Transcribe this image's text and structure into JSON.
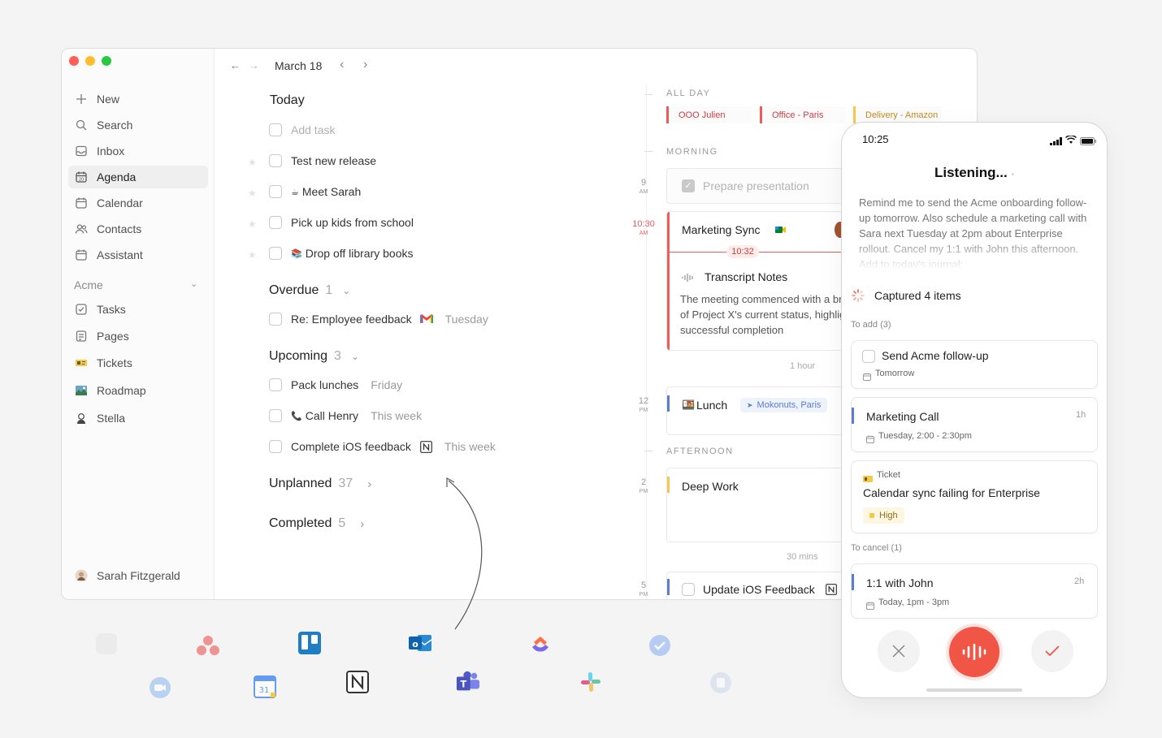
{
  "calendar_header": {
    "back_arrow": "←",
    "forward_arrow": "→",
    "date": "March 18",
    "prev": "‹",
    "next": "›"
  },
  "sidebar": {
    "items": [
      {
        "label": "New",
        "icon": "plus-icon"
      },
      {
        "label": "Search",
        "icon": "search-icon"
      },
      {
        "label": "Inbox",
        "icon": "inbox-icon"
      },
      {
        "label": "Agenda",
        "icon": "agenda-icon"
      },
      {
        "label": "Calendar",
        "icon": "calendar-icon"
      },
      {
        "label": "Contacts",
        "icon": "contacts-icon"
      },
      {
        "label": "Assistant",
        "icon": "assistant-icon"
      }
    ],
    "workspace": "Acme",
    "workspace_items": [
      {
        "label": "Tasks",
        "icon": "tasks-icon"
      },
      {
        "label": "Pages",
        "icon": "pages-icon"
      },
      {
        "label": "Tickets",
        "icon": "tickets-icon"
      },
      {
        "label": "Roadmap",
        "icon": "roadmap-icon"
      },
      {
        "label": "Stella",
        "icon": "stella-avatar"
      }
    ],
    "user": "Sarah Fitzgerald"
  },
  "agenda": {
    "today_title": "Today",
    "add_task_placeholder": "Add task",
    "today_tasks": [
      {
        "label": "Test new release"
      },
      {
        "emoji": "☕",
        "label": "Meet Sarah"
      },
      {
        "label": "Pick up kids from school"
      },
      {
        "emoji": "📚",
        "label": "Drop off library books"
      }
    ],
    "overdue": {
      "title": "Overdue",
      "count": "1",
      "chevron": "⌄"
    },
    "overdue_task": {
      "label": "Re: Employee feedback",
      "due": "Tuesday"
    },
    "upcoming": {
      "title": "Upcoming",
      "count": "3",
      "chevron": "⌄"
    },
    "upcoming_tasks": [
      {
        "label": "Pack lunches",
        "due": "Friday"
      },
      {
        "emoji": "📞",
        "label": "Call Henry",
        "due": "This week"
      },
      {
        "label": "Complete iOS feedback",
        "due": "This week"
      }
    ],
    "unplanned": {
      "title": "Unplanned",
      "count": "37",
      "chevron": "›"
    },
    "completed": {
      "title": "Completed",
      "count": "5",
      "chevron": "›"
    }
  },
  "calendar": {
    "all_day_label": "ALL DAY",
    "all_day_events": [
      "OOO Julien",
      "Office - Paris",
      "Delivery - Amazon"
    ],
    "morning_label": "MORNING",
    "afternoon_label": "AFTERNOON",
    "hours": [
      {
        "h": "9",
        "ap": "AM"
      },
      {
        "h": "10:30",
        "ap": "AM"
      },
      {
        "h": "12",
        "ap": "PM"
      },
      {
        "h": "2",
        "ap": "PM"
      },
      {
        "h": "5",
        "ap": "PM"
      }
    ],
    "prepare": "Prepare presentation",
    "marketing_sync": "Marketing Sync",
    "now_time": "10:32",
    "transcript_title": "Transcript Notes",
    "transcript_text": "The meeting commenced with a brief overview of Project X's current status, highlighted the successful completion",
    "one_hour": "1 hour",
    "lunch": "Lunch",
    "lunch_location": "Mokonuts, Paris",
    "deep_work": "Deep Work",
    "thirty_mins": "30 mins",
    "update_ios": "Update iOS Feedback"
  },
  "phone": {
    "time": "10:25",
    "listening": "Listening...",
    "transcript": "Remind me to send the Acme onboarding follow-up tomorrow. Also schedule a marketing call with Sara next Tuesday at 2pm about Enterprise rollout. Cancel my 1:1 with John this afternoon. Add to today's journal:",
    "captured": "Captured 4 items",
    "to_add": "To add (3)",
    "card1": {
      "title": "Send Acme follow-up",
      "date": "Tomorrow"
    },
    "card2": {
      "title": "Marketing Call",
      "duration": "1h",
      "date": "Tuesday, 2:00 - 2:30pm"
    },
    "card3": {
      "type": "Ticket",
      "title": "Calendar sync failing for Enterprise",
      "priority": "High"
    },
    "to_cancel": "To cancel (1)",
    "card4": {
      "title": "1:1 with John",
      "duration": "2h",
      "date": "Today, 1pm - 3pm"
    }
  },
  "colors": {
    "accent_red": "#f05545",
    "blue": "#5b7bd5",
    "yellow": "#f2c94c",
    "soft_red": "#ee5b5b"
  }
}
